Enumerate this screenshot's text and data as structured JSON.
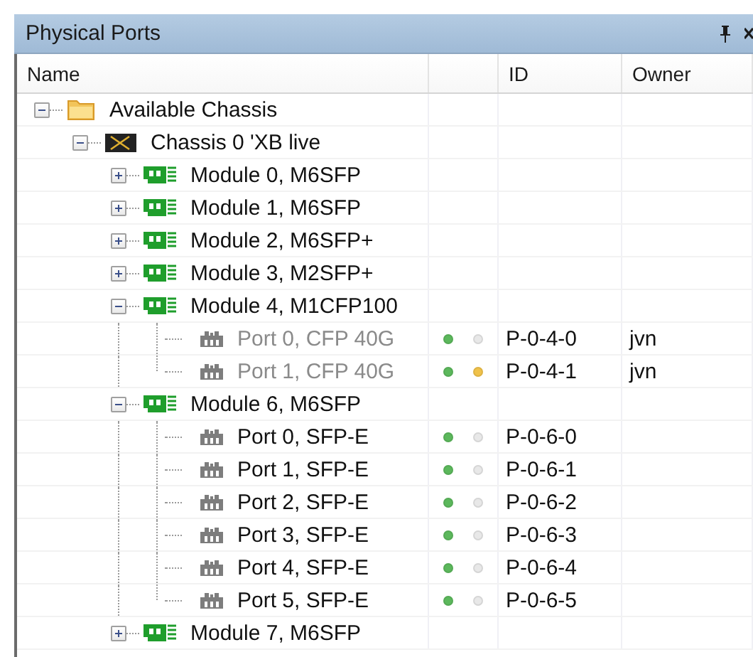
{
  "panel": {
    "title": "Physical Ports"
  },
  "columns": [
    {
      "label": "Name"
    },
    {},
    {
      "label": "ID"
    },
    {
      "label": "Owner"
    }
  ],
  "tree": [
    {
      "label": "Available Chassis",
      "kind": "folder",
      "expanded": true,
      "children": [
        {
          "label": "Chassis 0 'XB live",
          "kind": "chassis",
          "expanded": true,
          "children": [
            {
              "label": "Module 0, M6SFP",
              "kind": "module",
              "expanded": false
            },
            {
              "label": "Module 1, M6SFP",
              "kind": "module",
              "expanded": false
            },
            {
              "label": "Module 2, M6SFP+",
              "kind": "module",
              "expanded": false
            },
            {
              "label": "Module 3, M2SFP+",
              "kind": "module",
              "expanded": false
            },
            {
              "label": "Module 4, M1CFP100",
              "kind": "module",
              "expanded": true,
              "children": [
                {
                  "label": "Port 0, CFP 40G",
                  "kind": "port",
                  "disabled": true,
                  "dots": [
                    {
                      "color": "#5cb85c"
                    },
                    {
                      "color": "#e8e8e8"
                    }
                  ],
                  "id": "P-0-4-0",
                  "owner": "jvn"
                },
                {
                  "label": "Port 1, CFP 40G",
                  "kind": "port",
                  "disabled": true,
                  "dots": [
                    {
                      "color": "#5cb85c"
                    },
                    {
                      "color": "#f0c24a"
                    }
                  ],
                  "id": "P-0-4-1",
                  "owner": "jvn"
                }
              ]
            },
            {
              "label": "Module 6, M6SFP",
              "kind": "module",
              "expanded": true,
              "children": [
                {
                  "label": "Port 0, SFP-E",
                  "kind": "port",
                  "disabled": false,
                  "dots": [
                    {
                      "color": "#5cb85c"
                    },
                    {
                      "color": "#e8e8e8"
                    }
                  ],
                  "id": "P-0-6-0"
                },
                {
                  "label": "Port 1, SFP-E",
                  "kind": "port",
                  "disabled": false,
                  "dots": [
                    {
                      "color": "#5cb85c"
                    },
                    {
                      "color": "#e8e8e8"
                    }
                  ],
                  "id": "P-0-6-1"
                },
                {
                  "label": "Port 2, SFP-E",
                  "kind": "port",
                  "disabled": false,
                  "dots": [
                    {
                      "color": "#5cb85c"
                    },
                    {
                      "color": "#e8e8e8"
                    }
                  ],
                  "id": "P-0-6-2"
                },
                {
                  "label": "Port 3, SFP-E",
                  "kind": "port",
                  "disabled": false,
                  "dots": [
                    {
                      "color": "#5cb85c"
                    },
                    {
                      "color": "#e8e8e8"
                    }
                  ],
                  "id": "P-0-6-3"
                },
                {
                  "label": "Port 4, SFP-E",
                  "kind": "port",
                  "disabled": false,
                  "dots": [
                    {
                      "color": "#5cb85c"
                    },
                    {
                      "color": "#e8e8e8"
                    }
                  ],
                  "id": "P-0-6-4"
                },
                {
                  "label": "Port 5, SFP-E",
                  "kind": "port",
                  "disabled": false,
                  "dots": [
                    {
                      "color": "#5cb85c"
                    },
                    {
                      "color": "#e8e8e8"
                    }
                  ],
                  "id": "P-0-6-5"
                }
              ]
            },
            {
              "label": "Module 7, M6SFP",
              "kind": "module",
              "expanded": false
            }
          ]
        }
      ]
    }
  ]
}
